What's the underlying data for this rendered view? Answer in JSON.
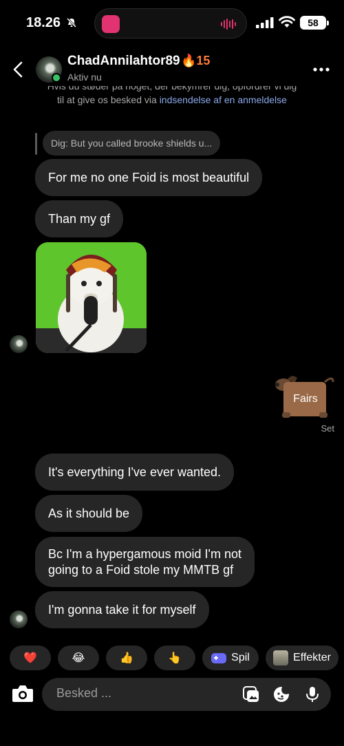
{
  "status_bar": {
    "time": "18.26",
    "battery": "58"
  },
  "header": {
    "name": "ChadAnnilahtor89",
    "streak": "🔥15",
    "subtitle": "Aktiv nu"
  },
  "notice": {
    "partial_line": "Hvis du støder på noget, der bekymrer dig, opfordrer vi dig",
    "line_prefix": "til at give os besked via ",
    "link_text": "indsendelse af en anmeldelse"
  },
  "thread": {
    "reply_preview": "Dig: But you called brooke shields u...",
    "messages": [
      {
        "text": "For me no one Foid is most beautiful"
      },
      {
        "text": "Than my gf"
      },
      {
        "text": "It's everything I've ever wanted."
      },
      {
        "text": "As it should be"
      },
      {
        "text": "Bc I'm a hypergamous moid I'm not\ngoing to a Foid stole my MMTB gf"
      },
      {
        "text": "I'm gonna take it for myself"
      }
    ],
    "sticker_text": "Fairs",
    "seen_label": "Set"
  },
  "quick_reactions": {
    "items": [
      "❤️",
      "😂",
      "👍",
      "👆"
    ],
    "game_label": "Spil",
    "effects_label": "Effekter"
  },
  "composer": {
    "placeholder": "Besked ..."
  },
  "colors": {
    "bubble": "#262626",
    "online": "#38c265",
    "link": "#8aa8e8",
    "streak": "#ff7b3a"
  }
}
